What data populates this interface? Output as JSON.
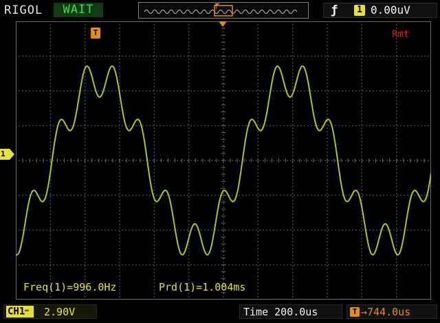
{
  "header": {
    "brand": "RIGOL",
    "run_status": "WAIT",
    "trigger": {
      "edge_icon": "rising-edge-icon",
      "source": "1",
      "level": "0.00uV"
    }
  },
  "screen": {
    "remote_indicator": "Rmt",
    "channel_marker": "1",
    "trigger_marker": "T",
    "measurements": {
      "freq": "Freq(1)=996.0Hz",
      "period": "Prd(1)=1.004ms"
    },
    "waveform": {
      "channel": "CH1",
      "main_frequency_hz": 996.0,
      "harmonic_ratio": 7,
      "color": "#b8c21e"
    }
  },
  "footer": {
    "channel_tag": "CH1",
    "coupling_icon": "dc-coupling-icon",
    "volts_per_div": "2.90V",
    "timebase": "Time 200.0us",
    "trigger_offset_icon": "trigger-offset-icon",
    "trigger_offset": "T→744.0us"
  },
  "colors": {
    "grid": "#6a6a6a",
    "channel1": "#e6e03c",
    "trace": "#b8c21e",
    "trigger": "#e68a1c",
    "remote": "#e01818",
    "status_wait": "#29e84a"
  }
}
